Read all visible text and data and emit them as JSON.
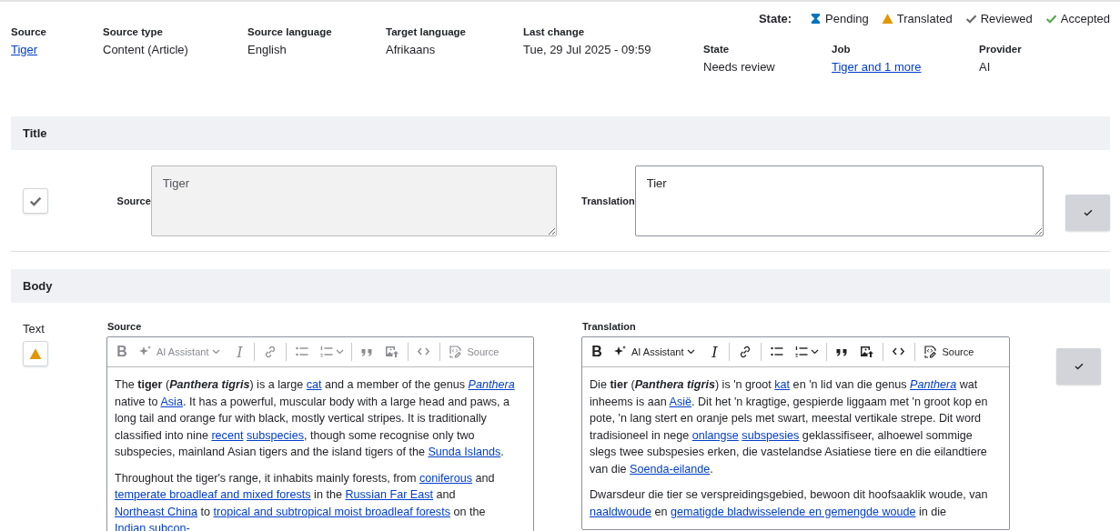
{
  "legend": {
    "label": "State:",
    "items": [
      {
        "kind": "pending",
        "label": "Pending"
      },
      {
        "kind": "translated",
        "label": "Translated"
      },
      {
        "kind": "reviewed",
        "label": "Reviewed"
      },
      {
        "kind": "accepted",
        "label": "Accepted"
      }
    ]
  },
  "meta": [
    {
      "label": "Source",
      "value": "Tiger",
      "kind": "link"
    },
    {
      "label": "Source type",
      "value": "Content (Article)",
      "kind": "text"
    },
    {
      "label": "Source language",
      "value": "English",
      "kind": "text"
    },
    {
      "label": "Target language",
      "value": "Afrikaans",
      "kind": "text"
    },
    {
      "label": "Last change",
      "value": "Tue, 29 Jul 2025 - 09:59",
      "kind": "text"
    }
  ],
  "job_meta": [
    {
      "label": "State",
      "value": "Needs review",
      "kind": "text"
    },
    {
      "label": "Job",
      "value": "Tiger and 1 more",
      "kind": "link"
    },
    {
      "label": "Provider",
      "value": "AI",
      "kind": "text"
    }
  ],
  "sections": [
    {
      "title": "Title",
      "fields": [
        {
          "kind": "plain",
          "status": {
            "kind": "reviewed"
          },
          "source_label": "Source",
          "source_value": "Tiger",
          "source_disabled": true,
          "translation_label": "Translation",
          "translation_value": "Tier",
          "translation_disabled": false
        }
      ]
    },
    {
      "title": "Body",
      "fields": [
        {
          "kind": "rich",
          "label": "Text",
          "status": {
            "kind": "translated"
          },
          "editors": [
            {
              "label": "Source",
              "disabled": true,
              "toolbar": [
                {
                  "kind": "bold",
                  "label": "B"
                },
                {
                  "kind": "ai",
                  "label": "AI Assistant"
                },
                {
                  "kind": "italic",
                  "label": "I"
                },
                {
                  "kind": "link"
                },
                {
                  "kind": "bullets"
                },
                {
                  "kind": "numbers"
                },
                {
                  "kind": "quote"
                },
                {
                  "kind": "image"
                },
                {
                  "kind": "code"
                },
                {
                  "kind": "source",
                  "label": "Source"
                }
              ],
              "paragraphs": [
                [
                  {
                    "kind": "plain",
                    "text": "The "
                  },
                  {
                    "kind": "bold",
                    "text": "tiger"
                  },
                  {
                    "kind": "plain",
                    "text": " ("
                  },
                  {
                    "kind": "bold_italic",
                    "text": "Panthera tigris"
                  },
                  {
                    "kind": "plain",
                    "text": ") is a large "
                  },
                  {
                    "kind": "link",
                    "text": "cat"
                  },
                  {
                    "kind": "plain",
                    "text": " and a member of the genus "
                  },
                  {
                    "kind": "italic_link",
                    "text": "Panthera"
                  },
                  {
                    "kind": "plain",
                    "text": " native to "
                  },
                  {
                    "kind": "link",
                    "text": "Asia"
                  },
                  {
                    "kind": "plain",
                    "text": ". It has a powerful, muscular body with a large head and paws, a long tail and orange fur with black, mostly vertical stripes. It is traditionally classified into nine "
                  },
                  {
                    "kind": "link",
                    "text": "recent"
                  },
                  {
                    "kind": "link",
                    "text": "subspecies"
                  },
                  {
                    "kind": "plain",
                    "text": ", though some recognise only two subspecies, mainland Asian tigers and the island tigers of the "
                  },
                  {
                    "kind": "link",
                    "text": "Sunda Islands"
                  },
                  {
                    "kind": "plain",
                    "text": "."
                  }
                ],
                [
                  {
                    "kind": "plain",
                    "text": "Throughout the tiger's range, it inhabits mainly forests, from "
                  },
                  {
                    "kind": "link",
                    "text": "coniferous"
                  },
                  {
                    "kind": "plain",
                    "text": " and "
                  },
                  {
                    "kind": "link",
                    "text": "temperate broadleaf and mixed forests"
                  },
                  {
                    "kind": "plain",
                    "text": " in the "
                  },
                  {
                    "kind": "link",
                    "text": "Russian Far East"
                  },
                  {
                    "kind": "plain",
                    "text": " and "
                  },
                  {
                    "kind": "link",
                    "text": "Northeast China"
                  },
                  {
                    "kind": "plain",
                    "text": " to "
                  },
                  {
                    "kind": "link",
                    "text": "tropical and subtropical moist broadleaf forests"
                  },
                  {
                    "kind": "plain",
                    "text": " on the "
                  },
                  {
                    "kind": "link",
                    "text": "Indian subcon-"
                  }
                ]
              ]
            },
            {
              "label": "Translation",
              "disabled": false,
              "toolbar": [
                {
                  "kind": "bold",
                  "label": "B"
                },
                {
                  "kind": "ai",
                  "label": "AI Assistant"
                },
                {
                  "kind": "italic",
                  "label": "I"
                },
                {
                  "kind": "link"
                },
                {
                  "kind": "bullets"
                },
                {
                  "kind": "numbers"
                },
                {
                  "kind": "quote"
                },
                {
                  "kind": "image"
                },
                {
                  "kind": "code"
                },
                {
                  "kind": "source",
                  "label": "Source"
                }
              ],
              "paragraphs": [
                [
                  {
                    "kind": "plain",
                    "text": "Die "
                  },
                  {
                    "kind": "bold",
                    "text": "tier"
                  },
                  {
                    "kind": "plain",
                    "text": " ("
                  },
                  {
                    "kind": "bold_italic",
                    "text": "Panthera tigris"
                  },
                  {
                    "kind": "plain",
                    "text": ") is 'n groot "
                  },
                  {
                    "kind": "link",
                    "text": "kat"
                  },
                  {
                    "kind": "plain",
                    "text": " en 'n lid van die genus "
                  },
                  {
                    "kind": "italic_link",
                    "text": "Panthera"
                  },
                  {
                    "kind": "plain",
                    "text": " wat inheems is aan "
                  },
                  {
                    "kind": "link",
                    "text": "Asië"
                  },
                  {
                    "kind": "plain",
                    "text": ". Dit het 'n kragtige, gespierde liggaam met 'n groot kop en pote, 'n lang stert en oranje pels met swart, meestal vertikale strepe. Dit word tradisioneel in nege "
                  },
                  {
                    "kind": "link",
                    "text": "onlangse"
                  },
                  {
                    "kind": "link",
                    "text": "subspesies"
                  },
                  {
                    "kind": "plain",
                    "text": " geklassifiseer, alhoewel sommige slegs twee subspesies erken, die vastelandse Asiatiese tiere en die eilandtiere van die "
                  },
                  {
                    "kind": "link",
                    "text": "Soenda-eilande"
                  },
                  {
                    "kind": "plain",
                    "text": "."
                  }
                ],
                [
                  {
                    "kind": "plain",
                    "text": "Dwarsdeur die tier se verspreidingsgebied, bewoon dit hoofsaaklik woude, van "
                  },
                  {
                    "kind": "link",
                    "text": "naaldwoude"
                  },
                  {
                    "kind": "plain",
                    "text": " en "
                  },
                  {
                    "kind": "link",
                    "text": "gematigde bladwisselende en gemengde woude"
                  },
                  {
                    "kind": "plain",
                    "text": " in die"
                  }
                ]
              ]
            }
          ]
        }
      ]
    }
  ]
}
